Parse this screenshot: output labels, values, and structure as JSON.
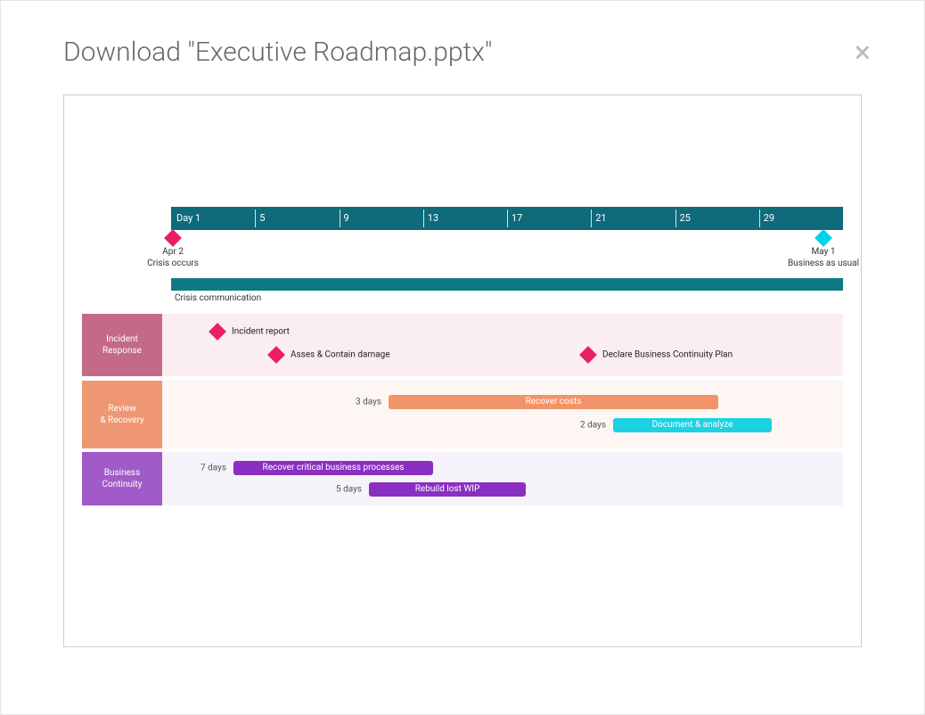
{
  "chart_data": {
    "type": "gantt",
    "title": "Executive Roadmap",
    "time_axis": {
      "unit": "day",
      "start": 1,
      "end": 30,
      "ticks": [
        1,
        5,
        9,
        13,
        17,
        21,
        25,
        29
      ],
      "tick_labels": [
        "Day 1",
        "5",
        "9",
        "13",
        "17",
        "21",
        "25",
        "29"
      ]
    },
    "milestones": [
      {
        "day": 1,
        "date": "Apr 2",
        "label": "Crisis occurs",
        "color": "magenta"
      },
      {
        "day": 30,
        "date": "May 1",
        "label": "Business as usual",
        "color": "cyan"
      }
    ],
    "global_bar": {
      "label": "Crisis communication",
      "start": 1,
      "end": 30,
      "color": "teal"
    },
    "swimlanes": [
      {
        "name": "Incident Response",
        "color": "#c46a86",
        "milestones": [
          {
            "day": 5,
            "label": "Incident report"
          },
          {
            "day": 8,
            "label": "Asses & Contain damage"
          },
          {
            "day": 21,
            "label": "Declare Business Continuity Plan"
          }
        ]
      },
      {
        "name": "Review & Recovery",
        "color": "#ef9772",
        "bars": [
          {
            "label": "Recover costs",
            "start": 12,
            "end": 27,
            "duration_label": "3 days",
            "color": "orange"
          },
          {
            "label": "Document & analyze",
            "start": 22,
            "end": 29,
            "duration_label": "2 days",
            "color": "cyan"
          }
        ]
      },
      {
        "name": "Business Continuity",
        "color": "#a15bc9",
        "bars": [
          {
            "label": "Recover critical business processes",
            "start": 6,
            "end": 14,
            "duration_label": "7 days",
            "color": "purple"
          },
          {
            "label": "Rebuild lost WIP",
            "start": 12,
            "end": 19,
            "duration_label": "5 days",
            "color": "purple"
          }
        ]
      }
    ]
  },
  "modal": {
    "title": "Download \"Executive Roadmap.pptx\"",
    "close": "×"
  },
  "timeline": {
    "ticks": [
      "Day 1",
      "5",
      "9",
      "13",
      "17",
      "21",
      "25",
      "29"
    ]
  },
  "ms1": {
    "date": "Apr 2",
    "label": "Crisis occurs"
  },
  "ms2": {
    "date": "May 1",
    "label": "Business as usual"
  },
  "comm": {
    "label": "Crisis communication"
  },
  "lane1": {
    "name_l1": "Incident",
    "name_l2": "Response",
    "p1": "Incident report",
    "p2": "Asses & Contain damage",
    "p3": "Declare Business Continuity Plan"
  },
  "lane2": {
    "name_l1": "Review",
    "name_l2": "& Recovery",
    "b1": {
      "dur": "3 days",
      "label": "Recover costs"
    },
    "b2": {
      "dur": "2 days",
      "label": "Document & analyze"
    }
  },
  "lane3": {
    "name_l1": "Business",
    "name_l2": "Continuity",
    "b1": {
      "dur": "7 days",
      "label": "Recover critical business processes"
    },
    "b2": {
      "dur": "5 days",
      "label": "Rebuild lost WIP"
    }
  }
}
